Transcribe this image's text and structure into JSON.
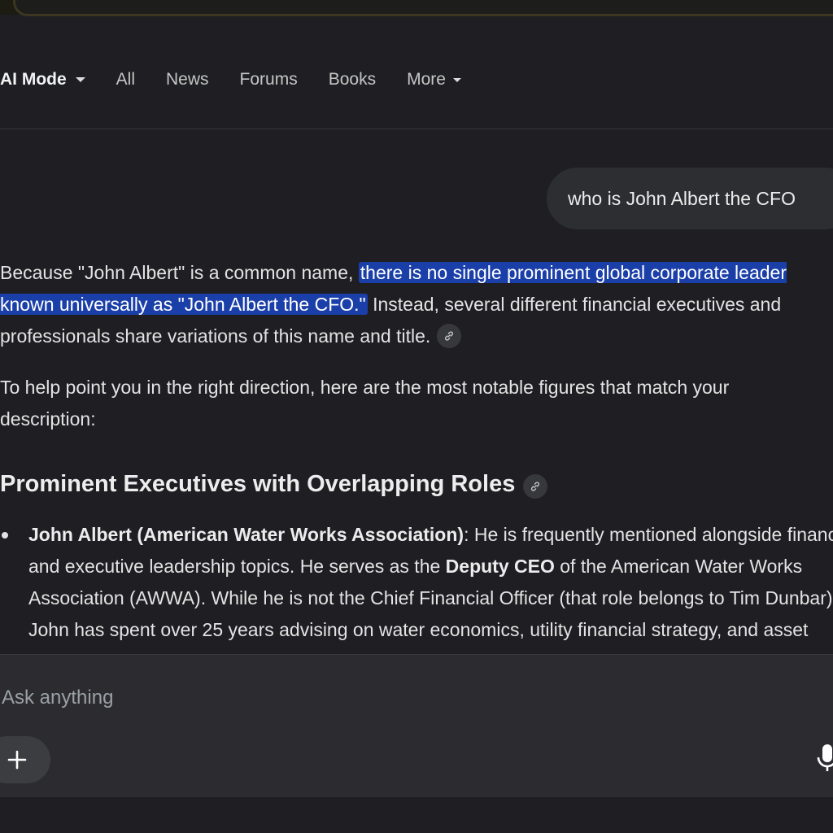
{
  "tabs": [
    {
      "label": "AI Mode",
      "dropdown": true,
      "active": true
    },
    {
      "label": "All",
      "dropdown": false,
      "active": false
    },
    {
      "label": "News",
      "dropdown": false,
      "active": false
    },
    {
      "label": "Forums",
      "dropdown": false,
      "active": false
    },
    {
      "label": "Books",
      "dropdown": false,
      "active": false
    },
    {
      "label": "More",
      "dropdown": true,
      "active": false
    }
  ],
  "conversation": {
    "user_query": "who is John Albert the CFO",
    "answer": {
      "intro_before_highlight": "Because \"John Albert\" is a common name, ",
      "intro_highlight": "there is no single prominent global corporate leader known universally as \"John Albert the CFO.\"",
      "intro_after_highlight": " Instead, several different financial executives and professionals share variations of this name and title.",
      "para2": "To help point you in the right direction, here are the most notable figures that match your description:",
      "heading": "Prominent Executives with Overlapping Roles",
      "bullets": [
        {
          "bold_name": "John Albert (American Water Works Association)",
          "text_before_bold": ": He is frequently mentioned alongside financial and executive leadership topics. He serves as the ",
          "bold_title": "Deputy CEO",
          "text_after_bold": " of the American Water Works Association (AWWA). While he is not the Chief Financial Officer (that role belongs to Tim Dunbar), John has spent over 25 years advising on water economics, utility financial strategy, and asset management."
        }
      ]
    }
  },
  "composer": {
    "placeholder": "Ask anything"
  },
  "icons": {
    "tab_dropdown": "caret-down-icon",
    "citation": "link-icon",
    "add": "plus-icon",
    "voice": "microphone-icon"
  },
  "colors": {
    "background": "#1f1f23",
    "highlight": "#1b3fa8",
    "bubble": "#2d2e31",
    "composer": "#2c2c30"
  }
}
